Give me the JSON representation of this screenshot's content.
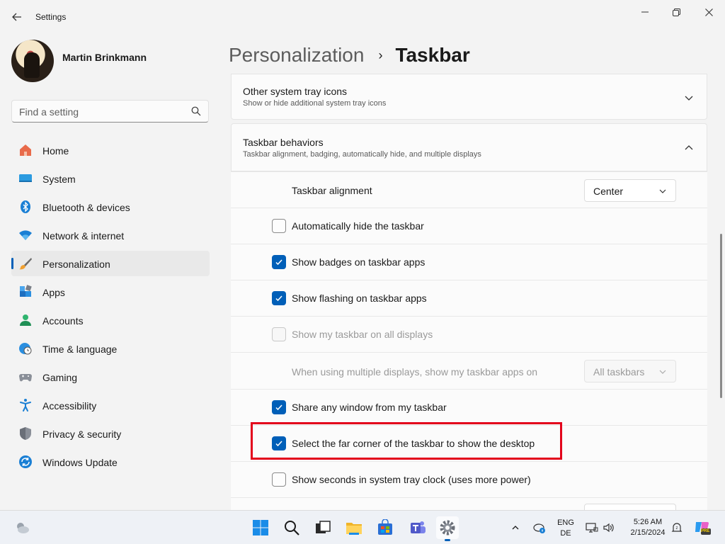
{
  "window": {
    "title": "Settings"
  },
  "profile": {
    "name": "Martin Brinkmann"
  },
  "search": {
    "placeholder": "Find a setting"
  },
  "nav": [
    {
      "label": "Home",
      "icon": "home-icon"
    },
    {
      "label": "System",
      "icon": "system-icon"
    },
    {
      "label": "Bluetooth & devices",
      "icon": "bluetooth-icon"
    },
    {
      "label": "Network & internet",
      "icon": "wifi-icon"
    },
    {
      "label": "Personalization",
      "icon": "brush-icon",
      "active": true
    },
    {
      "label": "Apps",
      "icon": "apps-icon"
    },
    {
      "label": "Accounts",
      "icon": "person-icon"
    },
    {
      "label": "Time & language",
      "icon": "clock-globe-icon"
    },
    {
      "label": "Gaming",
      "icon": "gamepad-icon"
    },
    {
      "label": "Accessibility",
      "icon": "accessibility-icon"
    },
    {
      "label": "Privacy & security",
      "icon": "shield-icon"
    },
    {
      "label": "Windows Update",
      "icon": "update-icon"
    }
  ],
  "breadcrumb": {
    "parent": "Personalization",
    "separator": "›",
    "current": "Taskbar"
  },
  "sections": {
    "tray": {
      "title": "Other system tray icons",
      "subtitle": "Show or hide additional system tray icons"
    },
    "behaviors": {
      "title": "Taskbar behaviors",
      "subtitle": "Taskbar alignment, badging, automatically hide, and multiple displays"
    }
  },
  "settings": {
    "alignment": {
      "label": "Taskbar alignment",
      "value": "Center"
    },
    "auto_hide": {
      "label": "Automatically hide the taskbar",
      "checked": false
    },
    "badges": {
      "label": "Show badges on taskbar apps",
      "checked": true
    },
    "flashing": {
      "label": "Show flashing on taskbar apps",
      "checked": true
    },
    "all_displays": {
      "label": "Show my taskbar on all displays",
      "checked": false,
      "disabled": true
    },
    "multi_display": {
      "label": "When using multiple displays, show my taskbar apps on",
      "value": "All taskbars",
      "disabled": true
    },
    "share_window": {
      "label": "Share any window from my taskbar",
      "checked": true
    },
    "far_corner": {
      "label": "Select the far corner of the taskbar to show the desktop",
      "checked": true
    },
    "seconds": {
      "label": "Show seconds in system tray clock (uses more power)",
      "checked": false
    }
  },
  "taskbar": {
    "lang_top": "ENG",
    "lang_bottom": "DE",
    "time": "5:26 AM",
    "date": "2/15/2024",
    "copilot_badge": "PRE"
  },
  "colors": {
    "accent": "#005fb8",
    "highlight": "#e3001b"
  }
}
